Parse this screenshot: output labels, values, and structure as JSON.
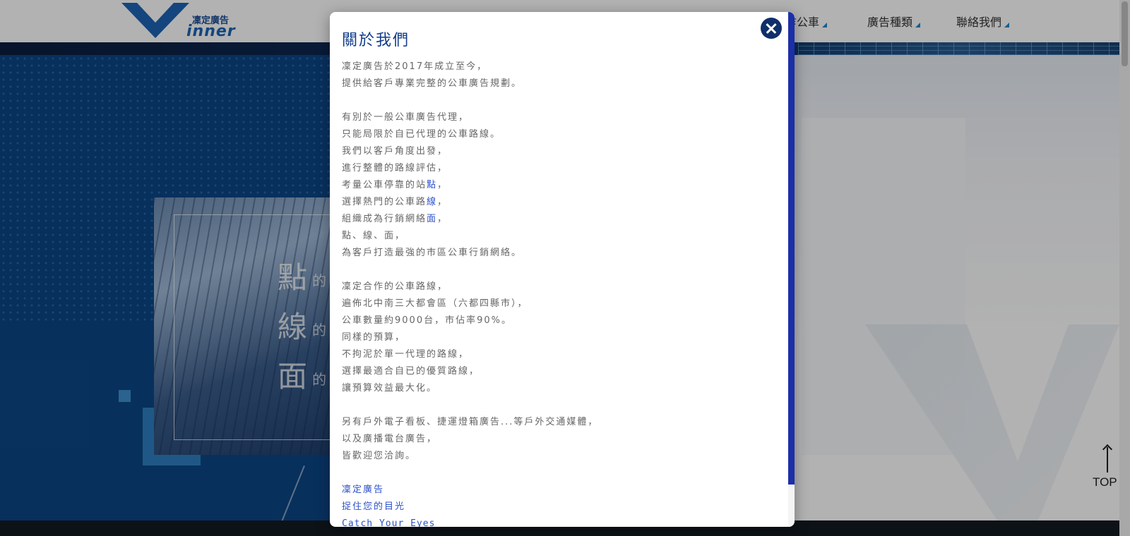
{
  "brand": {
    "logo_cn": "凜定廣告",
    "logo_en": "inner",
    "logo_accent": "#1e63b5"
  },
  "nav": {
    "items": [
      {
        "label": "合作公車"
      },
      {
        "label": "廣告種類"
      },
      {
        "label": "聯絡我們"
      }
    ],
    "visible_partial": "乍公車"
  },
  "hero": {
    "words": [
      "點",
      "線",
      "面"
    ],
    "suffix": "的"
  },
  "top_button": {
    "label": "TOP"
  },
  "modal": {
    "title": "關於我們",
    "close_icon": "close-icon",
    "accent": "#2c52c9",
    "paragraphs": [
      [
        "凜定廣告於2017年成立至今，",
        "提供給客戶專業完整的公車廣告規劃。"
      ],
      [
        "有別於一般公車廣告代理，",
        "只能局限於自已代理的公車路線。",
        "我們以客戶角度出發，",
        "進行整體的路線評估，"
      ],
      [
        "選擇熱門的公車路"
      ],
      [
        "組織成為行銷網絡"
      ],
      [
        "點、線、面，",
        "為客戶打造最強的市區公車行銷網絡。"
      ],
      [
        "凜定合作的公車路線，",
        "遍佈北中南三大都會區（六都四縣市），",
        "公車數量約9000台，市佔率90%。",
        "同樣的預算，",
        "不拘泥於單一代理的路線，",
        "選擇最適合自已的優質路線，",
        "讓預算效益最大化。"
      ],
      [
        "另有戶外電子看板、捷運燈箱廣告...等戶外交通媒體，",
        "以及廣播電台廣告，",
        "皆歡迎您洽詢。"
      ]
    ],
    "line_station_prefix": "考量公車停靠的站",
    "line_station_hl": "點",
    "line_route_prefix": "選擇熱門的公車路",
    "line_route_hl": "線",
    "line_network_prefix": "組織成為行銷網絡",
    "line_network_hl": "面",
    "comma": "，",
    "signature": [
      "凜定廣告",
      "捉住您的目光",
      "Catch Your Eyes"
    ]
  }
}
